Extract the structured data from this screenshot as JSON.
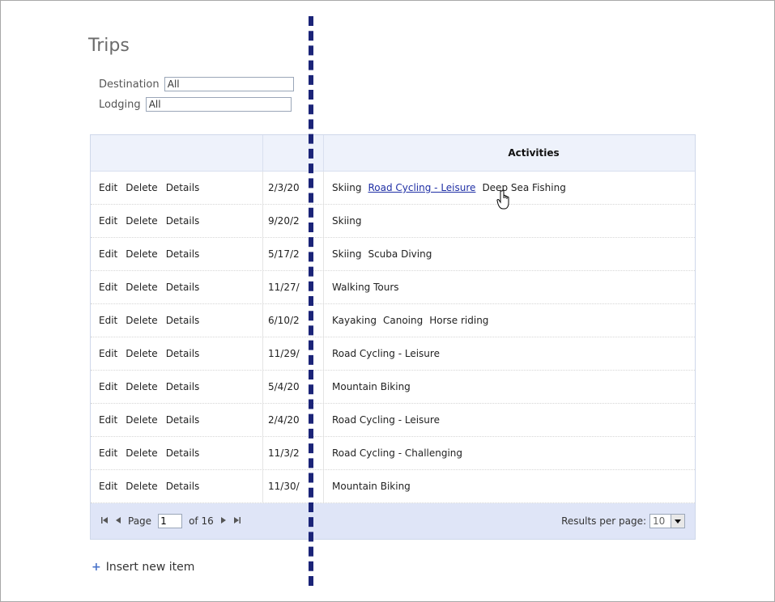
{
  "page": {
    "title": "Trips"
  },
  "filters": {
    "destination": {
      "label": "Destination",
      "value": "All"
    },
    "lodging": {
      "label": "Lodging",
      "value": "All"
    }
  },
  "grid": {
    "columns": [
      "",
      "",
      "Activities"
    ],
    "rows": [
      {
        "edit": "Edit",
        "delete": "Delete",
        "details": "Details",
        "date": "2/3/20",
        "activities": [
          "Skiing",
          "Road Cycling - Leisure",
          "Deep Sea Fishing"
        ],
        "hovered": 1
      },
      {
        "edit": "Edit",
        "delete": "Delete",
        "details": "Details",
        "date": "9/20/2",
        "activities": [
          "Skiing"
        ]
      },
      {
        "edit": "Edit",
        "delete": "Delete",
        "details": "Details",
        "date": "5/17/2",
        "activities": [
          "Skiing",
          "Scuba Diving"
        ]
      },
      {
        "edit": "Edit",
        "delete": "Delete",
        "details": "Details",
        "date": "11/27/",
        "activities": [
          "Walking Tours"
        ]
      },
      {
        "edit": "Edit",
        "delete": "Delete",
        "details": "Details",
        "date": "6/10/2",
        "activities": [
          "Kayaking",
          "Canoing",
          "Horse riding"
        ]
      },
      {
        "edit": "Edit",
        "delete": "Delete",
        "details": "Details",
        "date": "11/29/",
        "activities": [
          "Road Cycling - Leisure"
        ]
      },
      {
        "edit": "Edit",
        "delete": "Delete",
        "details": "Details",
        "date": "5/4/20",
        "activities": [
          "Mountain Biking"
        ]
      },
      {
        "edit": "Edit",
        "delete": "Delete",
        "details": "Details",
        "date": "2/4/20",
        "activities": [
          "Road Cycling - Leisure"
        ]
      },
      {
        "edit": "Edit",
        "delete": "Delete",
        "details": "Details",
        "date": "11/3/2",
        "activities": [
          "Road Cycling - Challenging"
        ]
      },
      {
        "edit": "Edit",
        "delete": "Delete",
        "details": "Details",
        "date": "11/30/",
        "activities": [
          "Mountain Biking"
        ]
      }
    ]
  },
  "pager": {
    "page_label": "Page",
    "current_page": "1",
    "of_label": "of 16",
    "results_label": "Results per page:",
    "results_value": "10"
  },
  "insert": {
    "label": "Insert new item"
  },
  "colors": {
    "divider": "#1b2478",
    "header_bg": "#eef2fb",
    "pager_bg": "#dfe5f7",
    "link": "#1f2fa5"
  },
  "icons": [
    "first-page-icon",
    "prev-page-icon",
    "next-page-icon",
    "last-page-icon",
    "dropdown-arrow-icon",
    "plus-icon",
    "hand-cursor-icon"
  ]
}
